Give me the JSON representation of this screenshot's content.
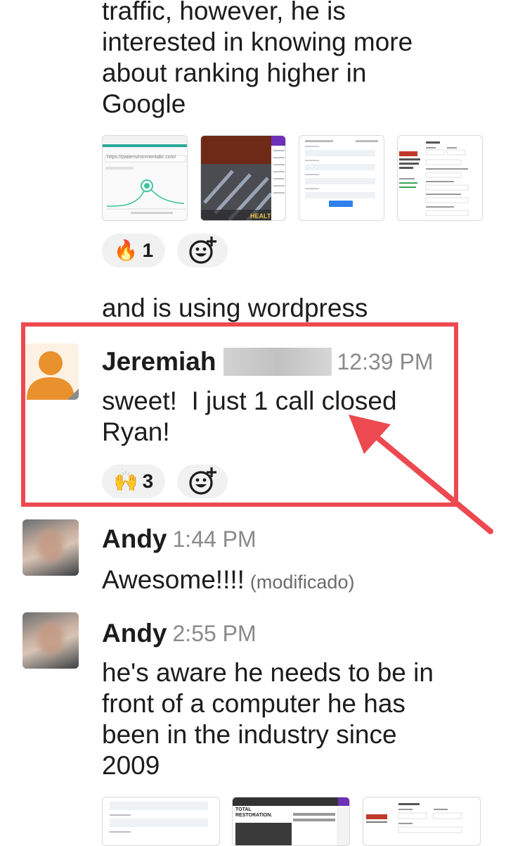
{
  "messages": {
    "first_continuation": {
      "text": "traffic, however, he is\ninterested in knowing more\nabout ranking higher in\nGoogle",
      "reaction": {
        "emoji_icon": "fire-emoji",
        "emoji": "🔥",
        "count": "1"
      },
      "followup_text": "and is using wordpress",
      "thumb1_url_text": "https://patienvironmentalic.com/"
    },
    "jeremiah": {
      "sender": "Jeremiah",
      "time": "12:39 PM",
      "text": "sweet!  I just 1 call closed\nRyan!",
      "reaction": {
        "emoji_icon": "raising-hands-emoji",
        "emoji": "🙌",
        "count": "3"
      }
    },
    "andy1": {
      "sender": "Andy",
      "time": "1:44 PM",
      "text": "Awesome!!!!",
      "edited": "(modificado)"
    },
    "andy2": {
      "sender": "Andy",
      "time": "2:55 PM",
      "text": "he's aware he needs to be in\nfront of a computer he has\nbeen in the industry since\n2009",
      "thumb2_text": "TOTAL\nRESTORATION."
    }
  },
  "colors": {
    "highlight": "#ec4a50",
    "avatar_orange": "#e8912d",
    "reaction_bg": "#f1f1f1",
    "time_grey": "#8a8a8a"
  }
}
